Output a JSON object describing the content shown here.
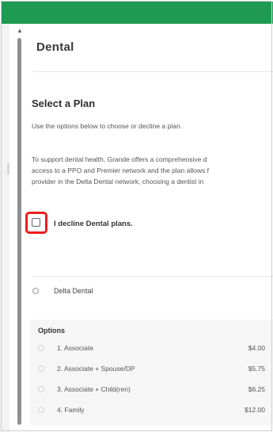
{
  "page": {
    "title": "Dental",
    "section_heading": "Select a Plan",
    "helper_text": "Use the options below to choose or decline a plan.",
    "description_lines": [
      "To support dental health, Grande offers a comprehensive d",
      "access to a PPO and Premier network and the plan allows f",
      "provider in the Delta Dental network, choosing a dentist in"
    ]
  },
  "decline": {
    "label": "I decline Dental plans.",
    "checked": false,
    "highlight_color": "#ee1c1c"
  },
  "plan": {
    "name": "Delta Dental",
    "selected": false
  },
  "options": {
    "label": "Options",
    "rows": [
      {
        "name": "1. Associate",
        "price": "$4.00"
      },
      {
        "name": "2. Associate + Spouse/DP",
        "price": "$5.75"
      },
      {
        "name": "3. Associate + Child(ren)",
        "price": "$6.25"
      },
      {
        "name": "4. Family",
        "price": "$12.00"
      }
    ]
  },
  "colors": {
    "header_green": "#1f9a52",
    "scrollbar": "#909090"
  },
  "icons": {
    "scroll_up": "scroll-up-arrow-icon"
  }
}
